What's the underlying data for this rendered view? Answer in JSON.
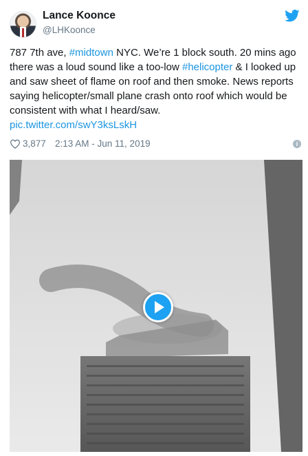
{
  "user": {
    "name": "Lance Koonce",
    "handle": "@LHKoonce"
  },
  "tweet": {
    "line1_a": "787 7th ave, ",
    "hashtag1": "#midtown",
    "line1_b": " NYC. We’re 1 block south. 20 mins ago there was a loud sound like a too-low ",
    "hashtag2": "#helicopter",
    "line1_c": " & I looked up and saw sheet of flame on roof and then smoke. News reports saying helicopter/small plane crash onto roof which would be consistent with what I heard/saw.",
    "link": "pic.twitter.com/swY3ksLskH"
  },
  "meta": {
    "likes": "3,877",
    "timestamp": "2:13 AM - Jun 11, 2019",
    "info_glyph": "i"
  },
  "icons": {
    "bird": "twitter-bird-icon",
    "heart": "heart-outline-icon",
    "info": "info-icon",
    "play": "play-icon"
  },
  "colors": {
    "link": "#1b95e0",
    "muted": "#657786",
    "play_button": "#1da1f2"
  }
}
